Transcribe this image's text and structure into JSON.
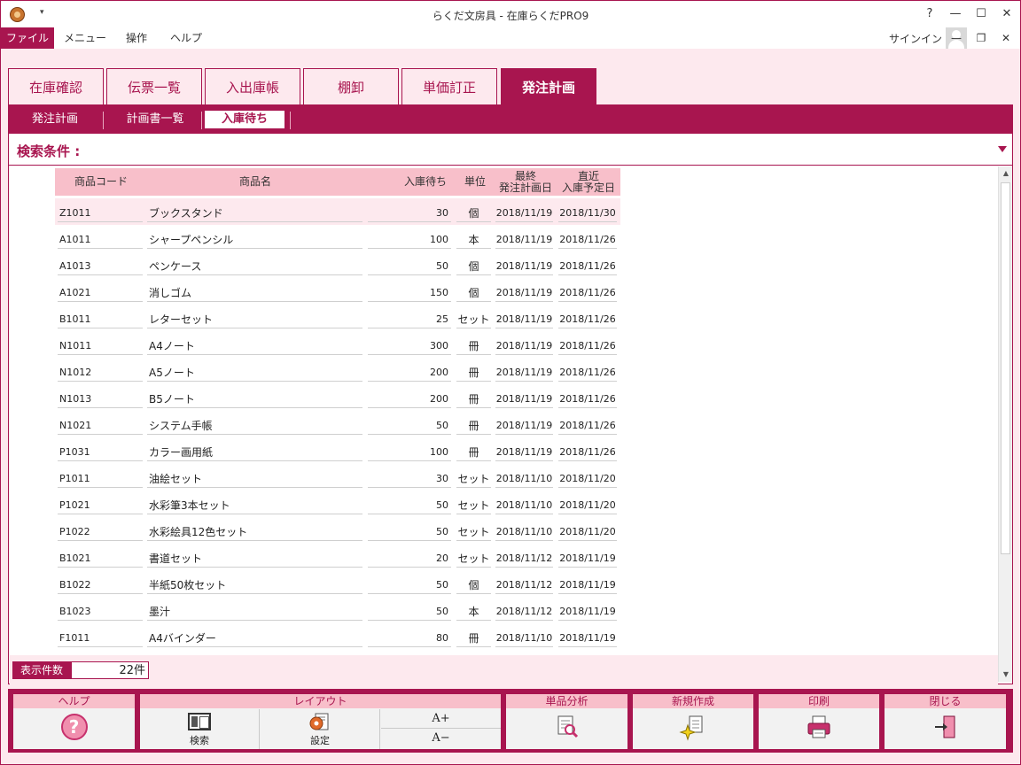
{
  "window": {
    "title": "らくだ文房具 - 在庫らくだPRO9",
    "help_glyph": "?",
    "minimize_glyph": "—",
    "maximize_glyph": "☐",
    "close_glyph": "✕"
  },
  "menubar": {
    "items": [
      "ファイル",
      "メニュー",
      "操作",
      "ヘルプ"
    ],
    "signin": "サインイン",
    "minimize_glyph": "—",
    "restore_glyph": "❐",
    "close_glyph": "✕"
  },
  "tabs": [
    "在庫確認",
    "伝票一覧",
    "入出庫帳",
    "棚卸",
    "単価訂正",
    "発注計画"
  ],
  "subtabs": [
    "発注計画",
    "計画書一覧",
    "入庫待ち"
  ],
  "search": {
    "label": "検索条件 :"
  },
  "table": {
    "headers": {
      "code": "商品コード",
      "name": "商品名",
      "qty": "入庫待ち",
      "unit": "単位",
      "last_order_1": "最終",
      "last_order_2": "発注計画日",
      "next_arrival_1": "直近",
      "next_arrival_2": "入庫予定日"
    },
    "rows": [
      {
        "code": "Z1011",
        "name": "ブックスタンド",
        "qty": "30",
        "unit": "個",
        "d1": "2018/11/19",
        "d2": "2018/11/30"
      },
      {
        "code": "A1011",
        "name": "シャープペンシル",
        "qty": "100",
        "unit": "本",
        "d1": "2018/11/19",
        "d2": "2018/11/26"
      },
      {
        "code": "A1013",
        "name": "ペンケース",
        "qty": "50",
        "unit": "個",
        "d1": "2018/11/19",
        "d2": "2018/11/26"
      },
      {
        "code": "A1021",
        "name": "消しゴム",
        "qty": "150",
        "unit": "個",
        "d1": "2018/11/19",
        "d2": "2018/11/26"
      },
      {
        "code": "B1011",
        "name": "レターセット",
        "qty": "25",
        "unit": "セット",
        "d1": "2018/11/19",
        "d2": "2018/11/26"
      },
      {
        "code": "N1011",
        "name": "A4ノート",
        "qty": "300",
        "unit": "冊",
        "d1": "2018/11/19",
        "d2": "2018/11/26"
      },
      {
        "code": "N1012",
        "name": "A5ノート",
        "qty": "200",
        "unit": "冊",
        "d1": "2018/11/19",
        "d2": "2018/11/26"
      },
      {
        "code": "N1013",
        "name": "B5ノート",
        "qty": "200",
        "unit": "冊",
        "d1": "2018/11/19",
        "d2": "2018/11/26"
      },
      {
        "code": "N1021",
        "name": "システム手帳",
        "qty": "50",
        "unit": "冊",
        "d1": "2018/11/19",
        "d2": "2018/11/26"
      },
      {
        "code": "P1031",
        "name": "カラー画用紙",
        "qty": "100",
        "unit": "冊",
        "d1": "2018/11/19",
        "d2": "2018/11/26"
      },
      {
        "code": "P1011",
        "name": "油絵セット",
        "qty": "30",
        "unit": "セット",
        "d1": "2018/11/10",
        "d2": "2018/11/20"
      },
      {
        "code": "P1021",
        "name": "水彩筆3本セット",
        "qty": "50",
        "unit": "セット",
        "d1": "2018/11/10",
        "d2": "2018/11/20"
      },
      {
        "code": "P1022",
        "name": "水彩絵具12色セット",
        "qty": "50",
        "unit": "セット",
        "d1": "2018/11/10",
        "d2": "2018/11/20"
      },
      {
        "code": "B1021",
        "name": "書道セット",
        "qty": "20",
        "unit": "セット",
        "d1": "2018/11/12",
        "d2": "2018/11/19"
      },
      {
        "code": "B1022",
        "name": "半紙50枚セット",
        "qty": "50",
        "unit": "個",
        "d1": "2018/11/12",
        "d2": "2018/11/19"
      },
      {
        "code": "B1023",
        "name": "墨汁",
        "qty": "50",
        "unit": "本",
        "d1": "2018/11/12",
        "d2": "2018/11/19"
      },
      {
        "code": "F1011",
        "name": "A4バインダー",
        "qty": "80",
        "unit": "冊",
        "d1": "2018/11/10",
        "d2": "2018/11/19"
      }
    ]
  },
  "count": {
    "label": "表示件数",
    "value": "22件"
  },
  "toolbar": {
    "help": {
      "head": "ヘルプ",
      "glyph": "?"
    },
    "layout": {
      "head": "レイアウト",
      "search": "検索",
      "settings": "設定",
      "font_up": "A+",
      "font_down": "A−"
    },
    "analysis": {
      "head": "単品分析"
    },
    "new": {
      "head": "新規作成"
    },
    "print": {
      "head": "印刷"
    },
    "close": {
      "head": "閉じる"
    }
  },
  "colors": {
    "accent": "#a8154f",
    "header_pink": "#f8bfca",
    "background_pink": "#fde9ee"
  }
}
